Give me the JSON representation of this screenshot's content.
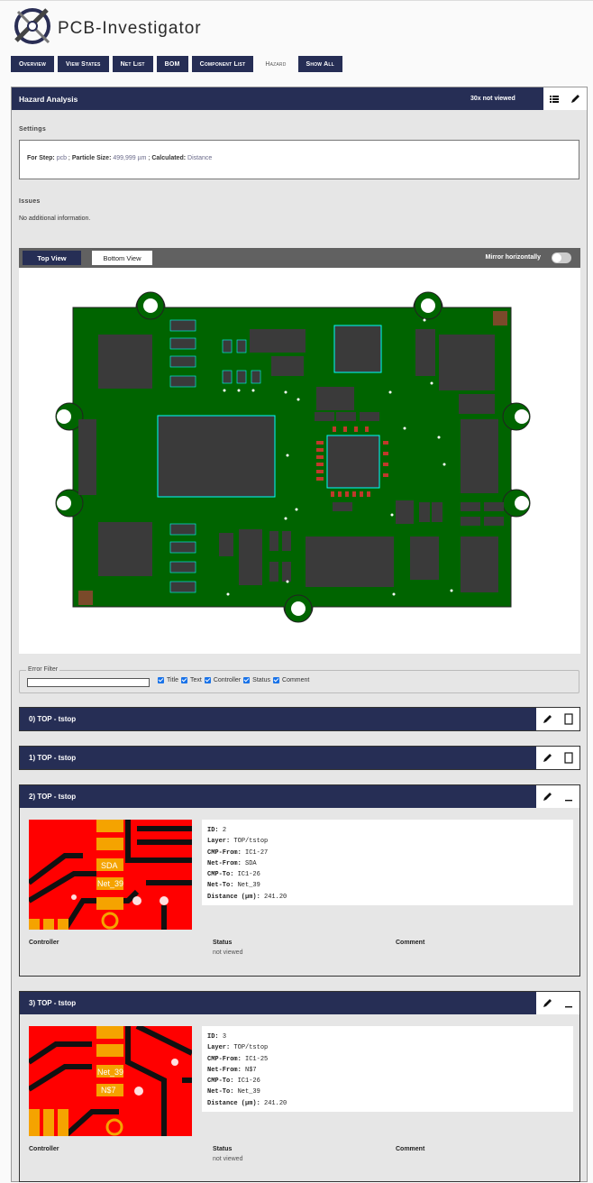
{
  "app": {
    "title": "PCB-Investigator"
  },
  "nav": [
    "Overview",
    "View States",
    "Net List",
    "BOM",
    "Component List",
    "Hazard",
    "Show All"
  ],
  "panel": {
    "title": "Hazard Analysis",
    "count": "30x not viewed"
  },
  "settings": {
    "heading": "Settings",
    "step_label": "For Step:",
    "step": "pcb",
    "particle_label": "Particle Size:",
    "particle": "499,999 µm",
    "calc_label": "Calculated:",
    "calc": "Distance"
  },
  "issues": {
    "heading": "Issues",
    "text": "No additional information."
  },
  "viewer": {
    "top": "Top View",
    "bottom": "Bottom View",
    "mirror": "Mirror horizontally"
  },
  "filter": {
    "legend": "Error Filter",
    "options": [
      "Title",
      "Text",
      "Controller",
      "Status",
      "Comment"
    ]
  },
  "items": [
    {
      "title": "0) TOP - tstop"
    },
    {
      "title": "1) TOP - tstop"
    },
    {
      "title": "2) TOP - tstop",
      "id": "2",
      "layer": "TOP/tstop",
      "cmp_from": "IC1-27",
      "net_from": "SDA",
      "cmp_to": "IC1-26",
      "net_to": "Net_39",
      "distance": "241.20",
      "tag1": "SDA",
      "tag2": "Net_39"
    },
    {
      "title": "3) TOP - tstop",
      "id": "3",
      "layer": "TOP/tstop",
      "cmp_from": "IC1-25",
      "net_from": "N$7",
      "cmp_to": "IC1-26",
      "net_to": "Net_39",
      "distance": "241.20",
      "tag1": "Net_39",
      "tag2": "N$7"
    }
  ],
  "fields": {
    "id": "ID:",
    "layer": "Layer:",
    "cmp_from": "CMP-From:",
    "net_from": "Net-From:",
    "cmp_to": "CMP-To:",
    "net_to": "Net-To:",
    "distance": "Distance (µm):"
  },
  "cols": {
    "controller": "Controller",
    "status": "Status",
    "comment": "Comment",
    "status_value": "not viewed"
  },
  "icons": {
    "list": "list-icon",
    "edit": "pencil-icon",
    "expand": "maximize-icon",
    "minimize": "minimize-icon"
  },
  "colors": {
    "navy": "#262e55",
    "board": "#006400",
    "hazard_red": "#ff0000",
    "pad_gold": "#f5a300"
  }
}
